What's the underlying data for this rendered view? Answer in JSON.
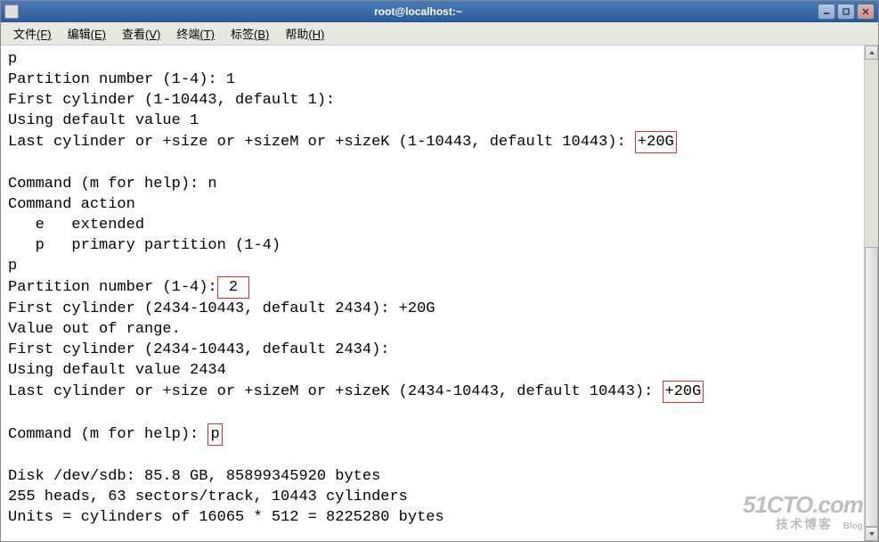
{
  "window": {
    "title": "root@localhost:~"
  },
  "menu": {
    "file": "文件",
    "file_key": "(F)",
    "edit": "编辑",
    "edit_key": "(E)",
    "view": "查看",
    "view_key": "(V)",
    "terminal": "终端",
    "terminal_key": "(T)",
    "tabs": "标签",
    "tabs_key": "(B)",
    "help": "帮助",
    "help_key": "(H)"
  },
  "terminal": {
    "lines": {
      "l0": "p",
      "l1": "Partition number (1-4): 1",
      "l2": "First cylinder (1-10443, default 1):",
      "l3": "Using default value 1",
      "l4a": "Last cylinder or +size or +sizeM or +sizeK (1-10443, default 10443): ",
      "l4b": "+20G",
      "l5": "",
      "l6": "Command (m for help): n",
      "l7": "Command action",
      "l8": "   e   extended",
      "l9": "   p   primary partition (1-4)",
      "l10": "p",
      "l11a": "Partition number (1-4):",
      "l11b": " 2 ",
      "l12": "First cylinder (2434-10443, default 2434): +20G",
      "l13": "Value out of range.",
      "l14": "First cylinder (2434-10443, default 2434):",
      "l15": "Using default value 2434",
      "l16a": "Last cylinder or +size or +sizeM or +sizeK (2434-10443, default 10443): ",
      "l16b": "+20G",
      "l17": "",
      "l18a": "Command (m for help): ",
      "l18b": "p",
      "l19": "",
      "l20": "Disk /dev/sdb: 85.8 GB, 85899345920 bytes",
      "l21": "255 heads, 63 sectors/track, 10443 cylinders",
      "l22": "Units = cylinders of 16065 * 512 = 8225280 bytes"
    }
  },
  "watermark": {
    "main": "51CTO.com",
    "sub": "技术博客",
    "blog": "Blog"
  }
}
